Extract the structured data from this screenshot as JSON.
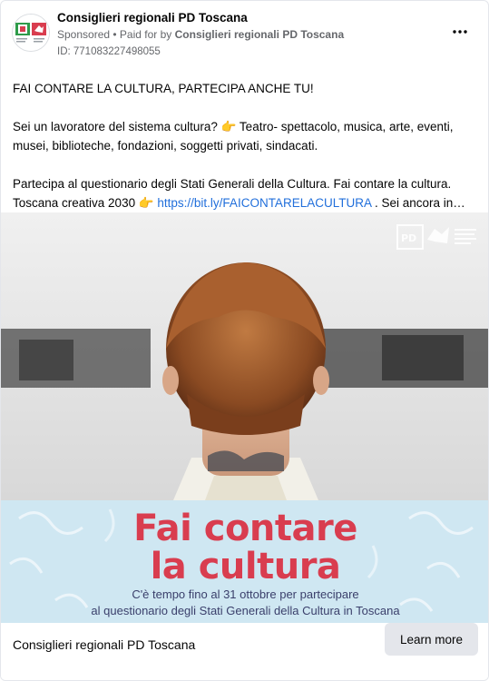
{
  "header": {
    "page_name": "Consiglieri regionali PD Toscana",
    "sponsored_label": "Sponsored",
    "paid_for_prefix": " • Paid for by ",
    "paid_for_name": "Consiglieri regionali PD Toscana",
    "ad_id": "ID: 771083227498055",
    "more_icon": "ellipsis-icon"
  },
  "post": {
    "line1": "FAI CONTARE LA CULTURA, PARTECIPA ANCHE TU!",
    "line2": "Sei un lavoratore del sistema cultura? 👉 Teatro- spettacolo, musica, arte, eventi,",
    "line3": "musei, biblioteche, fondazioni, soggetti privati, sindacati.",
    "line4": "Partecipa al questionario degli Stati Generali della Cultura. Fai contare la cultura.",
    "line5_prefix": "Toscana creativa 2030 👉 ",
    "line5_link": "https://bit.ly/FAICONTARELACULTURA",
    "line5_suffix": " . Sei ancora in…"
  },
  "media": {
    "banner_title_1": "Fai contare",
    "banner_title_2": "la cultura",
    "banner_sub_1": "C'è tempo fino al 31 ottobre per partecipare",
    "banner_sub_2": "al questionario degli Stati Generali della Cultura in Toscana",
    "accent_color": "#d93d4f",
    "banner_color": "#cfe7f2"
  },
  "footer": {
    "page_name": "Consiglieri regionali PD Toscana",
    "cta_label": "Learn more"
  }
}
